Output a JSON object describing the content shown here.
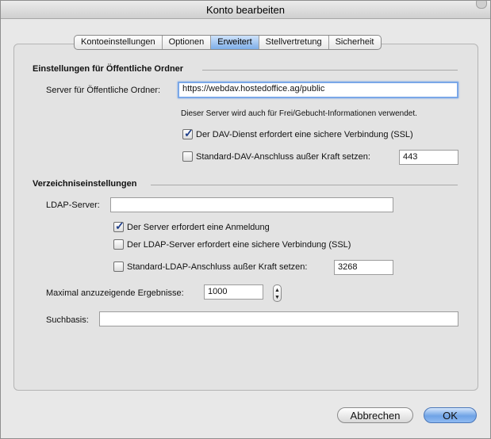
{
  "window": {
    "title": "Konto bearbeiten"
  },
  "tabs": [
    "Kontoeinstellungen",
    "Optionen",
    "Erweitert",
    "Stellvertretung",
    "Sicherheit"
  ],
  "active_tab": "Erweitert",
  "public_folders": {
    "section_title": "Einstellungen für Öffentliche Ordner",
    "server_label": "Server für Öffentliche Ordner:",
    "server_value": "https://webdav.hostedoffice.ag/public",
    "note": "Dieser Server wird auch für Frei/Gebucht-Informationen verwendet.",
    "ssl_label": "Der DAV-Dienst erfordert eine sichere Verbindung (SSL)",
    "ssl_checked": true,
    "port_override_label": "Standard-DAV-Anschluss außer Kraft setzen:",
    "port_override_checked": false,
    "port_value": "443"
  },
  "directory": {
    "section_title": "Verzeichniseinstellungen",
    "ldap_label": "LDAP-Server:",
    "ldap_value": "",
    "auth_label": "Der Server erfordert eine Anmeldung",
    "auth_checked": true,
    "ssl_label": "Der LDAP-Server erfordert eine sichere Verbindung (SSL)",
    "ssl_checked": false,
    "port_override_label": "Standard-LDAP-Anschluss außer Kraft setzen:",
    "port_override_checked": false,
    "port_value": "3268",
    "max_results_label": "Maximal anzuzeigende Ergebnisse:",
    "max_results_value": "1000",
    "searchbase_label": "Suchbasis:",
    "searchbase_value": ""
  },
  "buttons": {
    "cancel": "Abbrechen",
    "ok": "OK"
  }
}
